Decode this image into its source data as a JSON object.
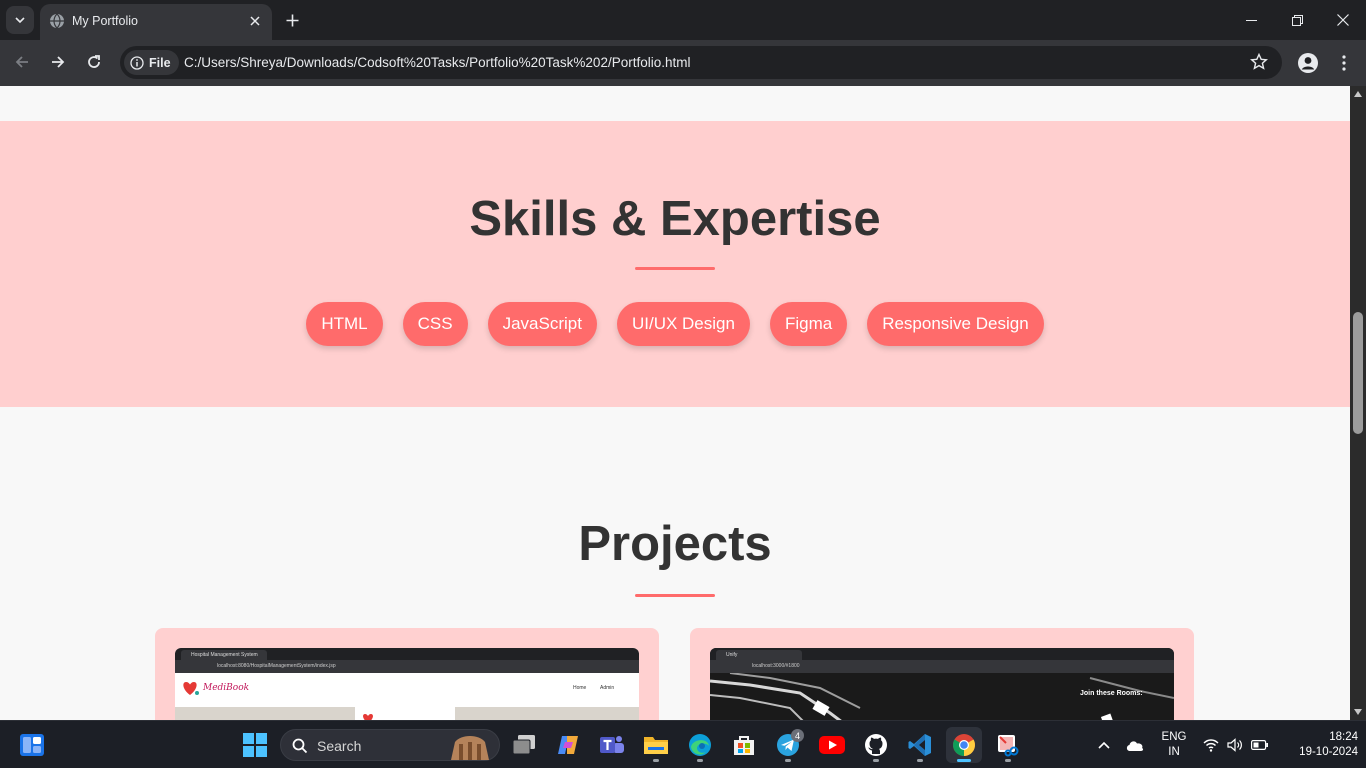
{
  "browser": {
    "tab_title": "My Portfolio",
    "site_chip": "File",
    "url": "C:/Users/Shreya/Downloads/Codsoft%20Tasks/Portfolio%20Task%202/Portfolio.html"
  },
  "page": {
    "skills_title": "Skills & Expertise",
    "skills": [
      "HTML",
      "CSS",
      "JavaScript",
      "UI/UX Design",
      "Figma",
      "Responsive Design"
    ],
    "projects_title": "Projects",
    "projects": [
      {
        "tab": "Hospital Management System",
        "url": "localhost:8080/HospitalManagementSystem/index.jsp",
        "brand": "MediBook",
        "nav": [
          "Home",
          "Admin"
        ]
      },
      {
        "tab": "Unify",
        "url": "localhost:3000/#1800",
        "caption": "Join these Rooms:"
      }
    ]
  },
  "taskbar": {
    "search_label": "Search",
    "telegram_badge": "4",
    "lang_top": "ENG",
    "lang_bottom": "IN",
    "time": "18:24",
    "date": "19-10-2024"
  },
  "colors": {
    "accent": "#ff6b6b",
    "skills_bg": "#ffcfcf",
    "heading": "#333333"
  }
}
